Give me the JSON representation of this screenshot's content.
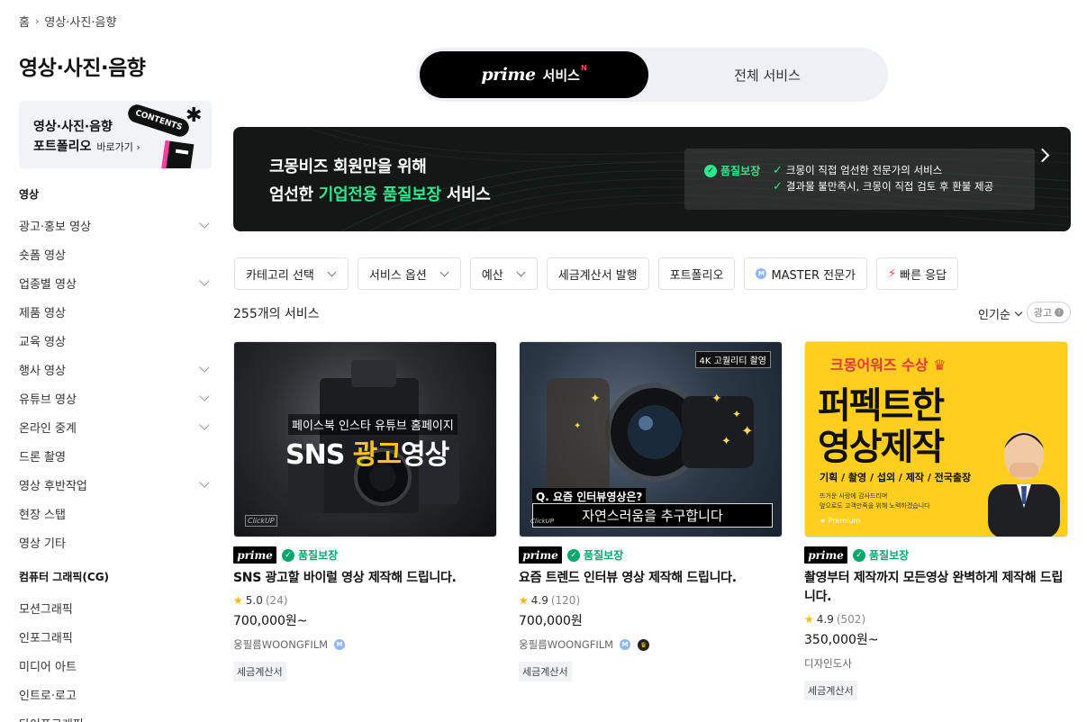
{
  "breadcrumb": {
    "home": "홈",
    "current": "영상·사진·음향"
  },
  "page_title": "영상·사진·음향",
  "portfolio_banner": {
    "line1": "영상·사진·음향",
    "line2": "포트폴리오",
    "more": "바로가기",
    "tag": "CONTENTS"
  },
  "sidebar": {
    "group1_title": "영상",
    "group1_items": [
      {
        "label": "광고·홍보 영상",
        "expandable": true
      },
      {
        "label": "숏폼 영상",
        "expandable": false
      },
      {
        "label": "업종별 영상",
        "expandable": true
      },
      {
        "label": "제품 영상",
        "expandable": false
      },
      {
        "label": "교육 영상",
        "expandable": false
      },
      {
        "label": "행사 영상",
        "expandable": true
      },
      {
        "label": "유튜브 영상",
        "expandable": true
      },
      {
        "label": "온라인 중계",
        "expandable": true
      },
      {
        "label": "드론 촬영",
        "expandable": false
      },
      {
        "label": "영상 후반작업",
        "expandable": true
      },
      {
        "label": "현장 스탭",
        "expandable": false
      },
      {
        "label": "영상 기타",
        "expandable": false
      }
    ],
    "group2_title": "컴퓨터 그래픽(CG)",
    "group2_items": [
      {
        "label": "모션그래픽"
      },
      {
        "label": "인포그래픽"
      },
      {
        "label": "미디어 아트"
      },
      {
        "label": "인트로·로고"
      },
      {
        "label": "타이포그래피"
      }
    ]
  },
  "service_toggle": {
    "prime_word": "prime",
    "prime_label": "서비스",
    "new_mark": "N",
    "all_label": "전체 서비스"
  },
  "hero": {
    "line1": "크몽비즈 회원만을 위해",
    "line2_pre": "엄선한 ",
    "line2_highlight": "기업전용 품질보장",
    "line2_post": " 서비스",
    "badge": "품질보장",
    "point1": "크몽이 직접 엄선한 전문가의 서비스",
    "point2": "결과물 불만족시, 크몽이 직접 검토 후 환불 제공"
  },
  "filters": {
    "category": "카테고리 선택",
    "option": "서비스 옵션",
    "budget": "예산",
    "tax": "세금계산서 발행",
    "portfolio": "포트폴리오",
    "master_badge": "M",
    "master": "MASTER 전문가",
    "fast": "빠른 응답"
  },
  "results": {
    "count": "255개의 서비스",
    "sort": "인기순",
    "ad": "광고"
  },
  "cards": [
    {
      "thumb_top": "페이스북 인스타 유튜브 홈페이지",
      "thumb_main_1": "SNS ",
      "thumb_main_2": "광고",
      "thumb_main_3": "영상",
      "thumb_watermark": "ClickUP",
      "prime": "prime",
      "quality": "품질보장",
      "title": "SNS 광고할 바이럴 영상 제작해 드립니다.",
      "rating": "5.0",
      "reviews": "(24)",
      "price": "700,000원~",
      "seller": "웅필름WOONGFILM",
      "seller_badge": "M",
      "tag": "세금계산서"
    },
    {
      "thumb_badge": "4K 고퀄리티 촬영",
      "thumb_q": "Q. 요즘 인터뷰영상은?",
      "thumb_a": "자연스러움을 추구합니다",
      "thumb_watermark": "ClickUP",
      "prime": "prime",
      "quality": "품질보장",
      "title": "요즘 트렌드 인터뷰 영상 제작해 드립니다.",
      "rating": "4.9",
      "reviews": "(120)",
      "price": "700,000원",
      "seller": "웅필름WOONGFILM",
      "seller_badge": "M",
      "tag": "세금계산서"
    },
    {
      "thumb_award": "크몽어워즈 수상",
      "thumb_line1": "퍼펙트한",
      "thumb_line2": "영상제작",
      "thumb_sub": "기획 / 촬영 / 섭외 / 제작 / 전국출장",
      "thumb_note1": "뜨거운 사랑에 감사드리며",
      "thumb_note2": "앞으로도 고객만족을 위해 노력하겠습니다",
      "thumb_premium": "Premium",
      "prime": "prime",
      "quality": "품질보장",
      "title": "촬영부터 제작까지 모든영상 완벽하게 제작해 드립니다.",
      "rating": "4.9",
      "reviews": "(502)",
      "price": "350,000원~",
      "seller": "디자인도사",
      "tag": "세금계산서"
    }
  ],
  "colors": {
    "quality_green": "#00a86b",
    "hero_green": "#2ee88e",
    "star": "#ffb800",
    "thumb3_bg": "#ffce1f"
  }
}
